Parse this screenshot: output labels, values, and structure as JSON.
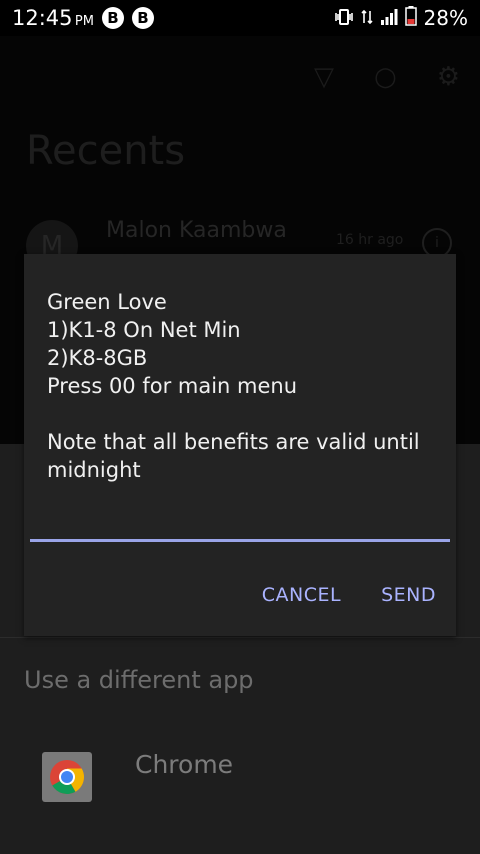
{
  "status_bar": {
    "time": "12:45",
    "ampm": "PM",
    "notif1": "B",
    "notif2": "B",
    "battery_percent": "28%"
  },
  "background_app": {
    "title": "Recents",
    "contact": {
      "avatar_letter": "M",
      "name": "Malon Kaambwa",
      "time": "16 hr ago"
    }
  },
  "dialog": {
    "message": "Green Love\n1)K1-8 On Net Min\n2)K8-8GB\nPress 00 for main menu\n\nNote that all benefits are valid until midnight",
    "input_value": "",
    "cancel_label": "CANCEL",
    "send_label": "SEND"
  },
  "sheet": {
    "title": "Use a different app",
    "app_name": "Chrome"
  },
  "colors": {
    "accent": "#aab3ff",
    "input_underline": "#9aa4e8",
    "dialog_bg": "#232323"
  }
}
